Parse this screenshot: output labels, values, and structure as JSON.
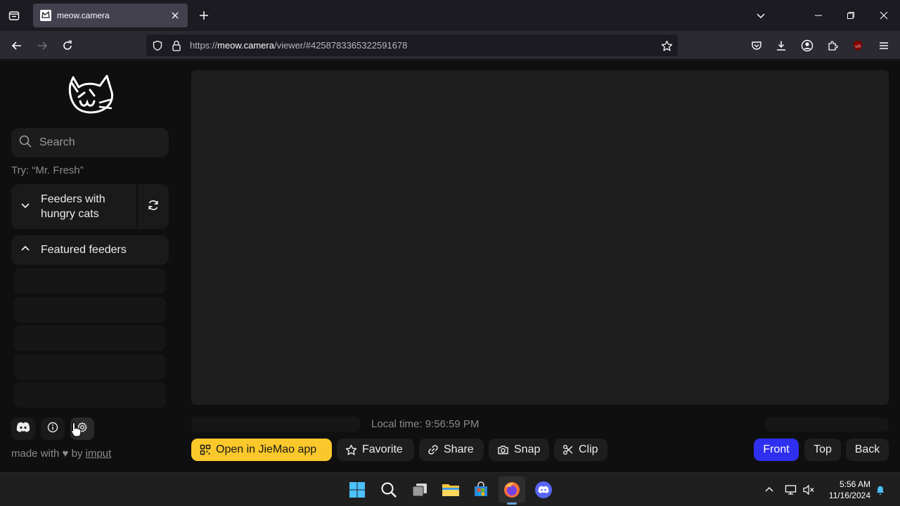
{
  "browser": {
    "tab_title": "meow.camera",
    "url_prefix": "https://",
    "url_host": "meow.camera",
    "url_path": "/viewer/#4258783365322591678"
  },
  "sidebar": {
    "search_placeholder": "Search",
    "hint": "Try: “Mr. Fresh”",
    "group_hungry": "Feeders with hungry cats",
    "group_featured": "Featured feeders",
    "made_with": "made with",
    "by": "by",
    "author": "imput"
  },
  "viewer": {
    "local_time": "Local time: 9:56:59 PM"
  },
  "actions": {
    "open_app": "Open in JieMao app",
    "favorite": "Favorite",
    "share": "Share",
    "snap": "Snap",
    "clip": "Clip"
  },
  "views": {
    "front": "Front",
    "top": "Top",
    "back": "Back",
    "active": "Front"
  },
  "taskbar": {
    "time": "5:56 AM",
    "date": "11/16/2024"
  },
  "colors": {
    "accent_yellow": "#fac82a",
    "accent_blue": "#2f2ff0"
  }
}
